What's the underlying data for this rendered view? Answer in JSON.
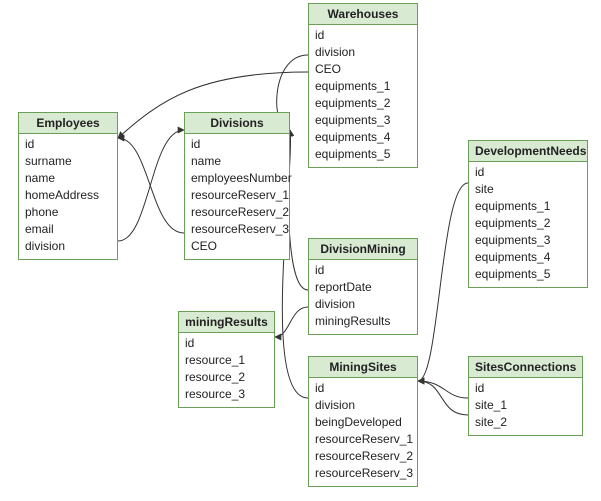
{
  "entities": {
    "employees": {
      "title": "Employees",
      "fields": [
        "id",
        "surname",
        "name",
        "homeAddress",
        "phone",
        "email",
        "division"
      ]
    },
    "divisions": {
      "title": "Divisions",
      "fields": [
        "id",
        "name",
        "employeesNumber",
        "resourceReserv_1",
        "resourceReserv_2",
        "resourceReserv_3",
        "CEO"
      ]
    },
    "warehouses": {
      "title": "Warehouses",
      "fields": [
        "id",
        "division",
        "CEO",
        "equipments_1",
        "equipments_2",
        "equipments_3",
        "equipments_4",
        "equipments_5"
      ]
    },
    "developmentNeeds": {
      "title": "DevelopmentNeeds",
      "fields": [
        "id",
        "site",
        "equipments_1",
        "equipments_2",
        "equipments_3",
        "equipments_4",
        "equipments_5"
      ]
    },
    "divisionMining": {
      "title": "DivisionMining",
      "fields": [
        "id",
        "reportDate",
        "division",
        "miningResults"
      ]
    },
    "miningResults": {
      "title": "miningResults",
      "fields": [
        "id",
        "resource_1",
        "resource_2",
        "resource_3"
      ]
    },
    "miningSites": {
      "title": "MiningSites",
      "fields": [
        "id",
        "division",
        "beingDeveloped",
        "resourceReserv_1",
        "resourceReserv_2",
        "resourceReserv_3"
      ]
    },
    "sitesConnections": {
      "title": "SitesConnections",
      "fields": [
        "id",
        "site_1",
        "site_2"
      ]
    }
  },
  "relationships": [
    {
      "from": "Employees.division",
      "to": "Divisions.id"
    },
    {
      "from": "Divisions.CEO",
      "to": "Employees.id"
    },
    {
      "from": "Warehouses.division",
      "to": "Divisions.id"
    },
    {
      "from": "Warehouses.CEO",
      "to": "Employees.id"
    },
    {
      "from": "DivisionMining.division",
      "to": "Divisions.id"
    },
    {
      "from": "DivisionMining.miningResults",
      "to": "miningResults.id"
    },
    {
      "from": "MiningSites.division",
      "to": "Divisions.id"
    },
    {
      "from": "DevelopmentNeeds.site",
      "to": "MiningSites.id"
    },
    {
      "from": "SitesConnections.site_1",
      "to": "MiningSites.id"
    },
    {
      "from": "SitesConnections.site_2",
      "to": "MiningSites.id"
    }
  ],
  "colors": {
    "headerBg": "#d9ead3",
    "border": "#6a9f58",
    "line": "#333333"
  }
}
